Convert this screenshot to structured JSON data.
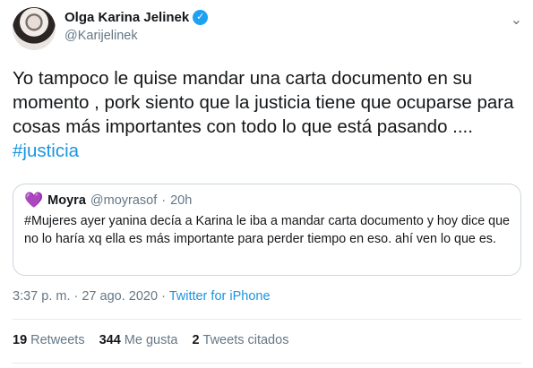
{
  "author": {
    "name": "Olga Karina Jelinek",
    "handle": "@Karijelinek",
    "verified_mark": "✓"
  },
  "menu_icon": "chevron-down-icon",
  "tweet": {
    "text": "Yo tampoco le quise mandar una carta documento en su momento , pork siento que la justicia tiene que ocuparse para cosas más importantes con todo lo que está pasando ....",
    "hashtag": "#justicia"
  },
  "quoted": {
    "emoji": "💜",
    "name": "Moyra",
    "handle": "@moyrasof",
    "separator": "·",
    "time": "20h",
    "text": "#Mujeres ayer yanina decía a Karina le iba a mandar carta documento y hoy dice que no lo haría xq ella es más importante para perder tiempo en eso. ahí ven lo que es."
  },
  "meta": {
    "timestamp": "3:37 p. m. · 27 ago. 2020",
    "separator": "·",
    "source": "Twitter for iPhone"
  },
  "stats": {
    "retweets_count": "19",
    "retweets_label": "Retweets",
    "likes_count": "344",
    "likes_label": "Me gusta",
    "quotes_count": "2",
    "quotes_label": "Tweets citados"
  },
  "colors": {
    "link": "#1b95e0",
    "muted": "#657786",
    "verified": "#1da1f2",
    "border": "#ccd6dd"
  }
}
